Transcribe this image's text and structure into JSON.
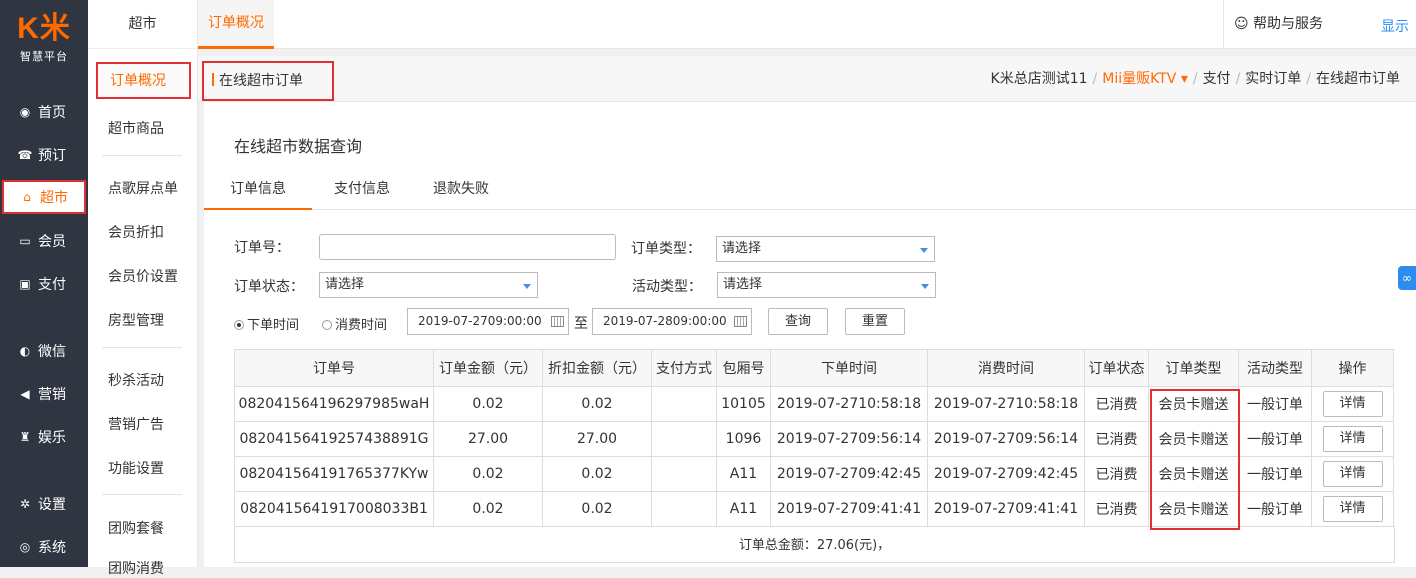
{
  "logo": {
    "mark": "K米",
    "sub": "智慧平台"
  },
  "leftnav": [
    {
      "label": "首页",
      "icon": "dashboard-icon",
      "glyph": "◉"
    },
    {
      "label": "预订",
      "icon": "phone-icon",
      "glyph": "☎"
    },
    {
      "label": "超市",
      "icon": "basket-icon",
      "glyph": "⌂"
    },
    {
      "label": "会员",
      "icon": "card-icon",
      "glyph": "▭"
    },
    {
      "label": "支付",
      "icon": "payment-icon",
      "glyph": "▣"
    },
    {
      "label": "微信",
      "icon": "wechat-icon",
      "glyph": "◐"
    },
    {
      "label": "营销",
      "icon": "megaphone-icon",
      "glyph": "◀"
    },
    {
      "label": "娱乐",
      "icon": "entertainment-icon",
      "glyph": "♜"
    },
    {
      "label": "设置",
      "icon": "gear-icon",
      "glyph": "✲"
    },
    {
      "label": "系统",
      "icon": "system-icon",
      "glyph": "◎"
    }
  ],
  "subnav": {
    "head": "超市",
    "items": [
      "订单概况",
      "超市商品",
      "点歌屏点单",
      "会员折扣",
      "会员价设置",
      "房型管理",
      "秒杀活动",
      "营销广告",
      "功能设置",
      "团购套餐",
      "团购消费"
    ]
  },
  "topbar": {
    "tab": "订单概况",
    "help": "帮助与服务",
    "show": "显示"
  },
  "crumb": {
    "title": "在线超市订单",
    "path": [
      "K米总店测试11",
      "Mii量贩KTV",
      "支付",
      "实时订单",
      "在线超市订单"
    ]
  },
  "card": {
    "title": "在线超市数据查询",
    "tabs": [
      "订单信息",
      "支付信息",
      "退款失败"
    ]
  },
  "filters": {
    "order_no_label": "订单号：",
    "order_no_value": "",
    "order_type_label": "订单类型：",
    "order_type_value": "请选择",
    "status_label": "订单状态：",
    "status_value": "请选择",
    "activity_label": "活动类型：",
    "activity_value": "请选择",
    "radio_order_time": "下单时间",
    "radio_consume_time": "消费时间",
    "date_from": "2019-07-27 09:00:00",
    "to": "至",
    "date_to": "2019-07-28 09:00:00",
    "query": "查询",
    "reset": "重置"
  },
  "table": {
    "headers": [
      "订单号",
      "订单金额（元）",
      "折扣金额（元）",
      "支付方式",
      "包厢号",
      "下单时间",
      "消费时间",
      "订单状态",
      "订单类型",
      "活动类型",
      "操作"
    ],
    "rows": [
      [
        "082041564196297985waH",
        "0.02",
        "0.02",
        "",
        "10105",
        "2019-07-27 10:58:18",
        "2019-07-27 10:58:18",
        "已消费",
        "会员卡赠送",
        "一般订单",
        "详情"
      ],
      [
        "082041564192574388 91G",
        "27.00",
        "27.00",
        "",
        "1096",
        "2019-07-27 09:56:14",
        "2019-07-27 09:56:14",
        "已消费",
        "会员卡赠送",
        "一般订单",
        "详情"
      ],
      [
        "082041564191765377KYw",
        "0.02",
        "0.02",
        "",
        "A11",
        "2019-07-27 09:42:45",
        "2019-07-27 09:42:45",
        "已消费",
        "会员卡赠送",
        "一般订单",
        "详情"
      ],
      [
        "08204156419170080 33B1",
        "0.02",
        "0.02",
        "",
        "A11",
        "2019-07-27 09:41:41",
        "2019-07-27 09:41:41",
        "已消费",
        "会员卡赠送",
        "一般订单",
        "详情"
      ]
    ],
    "total": "订单总金额：27.06(元)，"
  },
  "colors": {
    "accent": "#ff6a00",
    "nav_bg": "#2f3541",
    "highlight": "#e03030",
    "link": "#2d8cf0"
  }
}
